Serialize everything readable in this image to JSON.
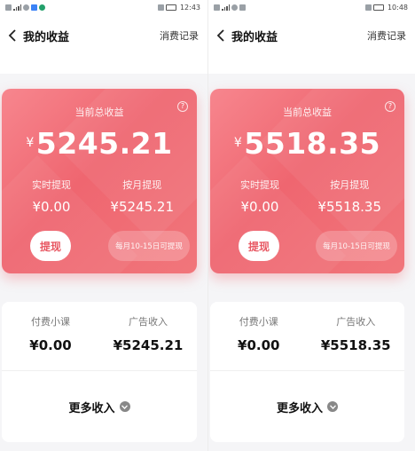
{
  "screens": [
    {
      "status": {
        "time": "12:43"
      },
      "nav": {
        "title": "我的收益",
        "right": "消费记录"
      },
      "card": {
        "total_label": "当前总收益",
        "currency": "¥",
        "total_amount": "5245.21",
        "realtime_label": "实时提现",
        "realtime_value": "¥0.00",
        "monthly_label": "按月提现",
        "monthly_value": "¥5245.21",
        "withdraw_button": "提现",
        "monthly_note": "每月10-15日可提现"
      },
      "income": {
        "paid_label": "付费小课",
        "paid_value": "¥0.00",
        "ad_label": "广告收入",
        "ad_value": "¥5245.21",
        "more_label": "更多收入"
      }
    },
    {
      "status": {
        "time": "10:48"
      },
      "nav": {
        "title": "我的收益",
        "right": "消费记录"
      },
      "card": {
        "total_label": "当前总收益",
        "currency": "¥",
        "total_amount": "5518.35",
        "realtime_label": "实时提现",
        "realtime_value": "¥0.00",
        "monthly_label": "按月提现",
        "monthly_value": "¥5518.35",
        "withdraw_button": "提现",
        "monthly_note": "每月10-15日可提现"
      },
      "income": {
        "paid_label": "付费小课",
        "paid_value": "¥0.00",
        "ad_label": "广告收入",
        "ad_value": "¥5518.35",
        "more_label": "更多收入"
      }
    }
  ],
  "colors": {
    "card_start": "#f7868e",
    "card_end": "#ef6670",
    "accent_text": "#e7505b"
  },
  "icons": [
    "back-chevron-icon",
    "help-icon",
    "chevron-down-icon",
    "signal-icon",
    "wifi-icon",
    "battery-icon"
  ]
}
